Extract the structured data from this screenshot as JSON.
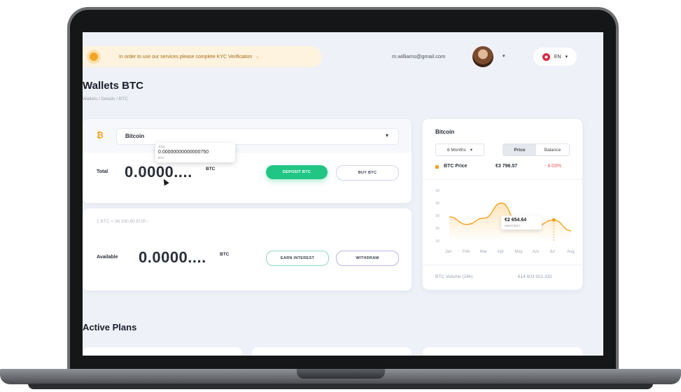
{
  "topbar": {
    "kyc_text": "In order to use our services please complete KYC Verification",
    "kyc_arrow": "›",
    "email": "m.williams@gmail.com",
    "avatar_caret": "▾",
    "language": "EN",
    "language_caret": "▾"
  },
  "page": {
    "title": "Wallets BTC",
    "breadcrumb": "Wallets / Details / BTC"
  },
  "wallet": {
    "coin_icon": "₿",
    "coin_name": "Bitcoin",
    "coin_caret": "▾",
    "tooltip": {
      "label": "Total",
      "value": "0.00000000000000750",
      "unit": "BTC"
    },
    "total_label": "Total",
    "total_value": "0.0000....",
    "total_unit": "BTC",
    "deposit_label": "DEPOSIT BTC",
    "buy_label": "BUY BTC",
    "rate_text": "1 BTC = 36 330.60 EUR ↑",
    "available_label": "Available",
    "available_value": "0.0000....",
    "available_unit": "BTC",
    "earn_label": "EARN INTEREST",
    "withdraw_label": "WITHDRAW"
  },
  "panel": {
    "title": "Bitcoin",
    "period": "6 Months",
    "period_caret": "▾",
    "toggle": [
      "Price",
      "Balance"
    ],
    "price_name": "BTC Price",
    "price_value": "€3 796.57",
    "price_change": "- 4.03%",
    "tooltip_value": "€2 654.64",
    "tooltip_date": "03/07/2017",
    "volume_label": "BTC Volume (24h)",
    "volume_value": "€14 603 921.332"
  },
  "colors": {
    "accent_green": "#21c685",
    "btc_orange": "#f3a11b",
    "negative": "#f0525a"
  },
  "chart_data": {
    "type": "area",
    "x": [
      "Jan",
      "Feb",
      "Mar",
      "Apr",
      "May",
      "Jun",
      "Jul",
      "Aug"
    ],
    "y_ticks": [
      "5K",
      "4K",
      "3K",
      "2K",
      "1K"
    ],
    "values": [
      2.9,
      2.3,
      2.8,
      4.0,
      2.3,
      2.2,
      2.65,
      1.8
    ],
    "ylim": [
      1,
      5
    ]
  },
  "plans": {
    "title": "Active Plans"
  }
}
